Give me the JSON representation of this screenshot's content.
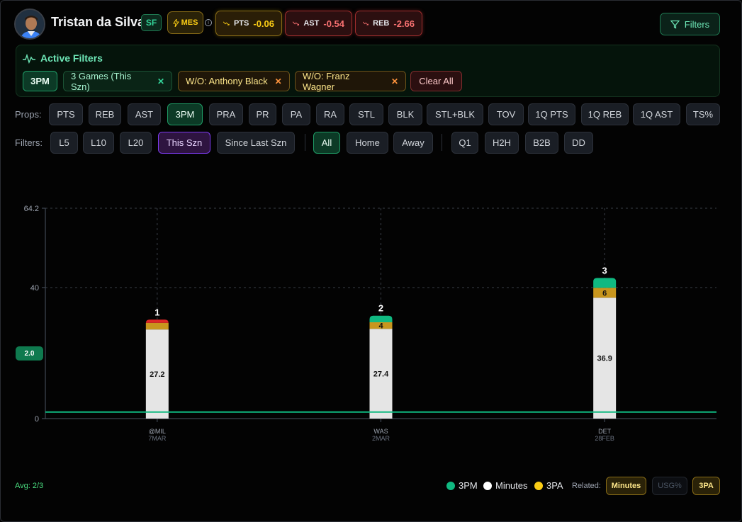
{
  "player": {
    "name": "Tristan da Silva",
    "position": "SF",
    "badge": "MES",
    "avatar_icon": "player-headshot"
  },
  "stats": [
    {
      "label": "PTS",
      "value": "-0.06"
    },
    {
      "label": "AST",
      "value": "-0.54"
    },
    {
      "label": "REB",
      "value": "-2.66"
    }
  ],
  "filters_button": "Filters",
  "active_filters": {
    "title": "Active Filters",
    "tags": [
      "3PM",
      "3 Games (This Szn)",
      "W/O: Anthony Black",
      "W/O: Franz Wagner"
    ],
    "clear_label": "Clear All"
  },
  "props": {
    "label": "Props:",
    "items": [
      "PTS",
      "REB",
      "AST",
      "3PM",
      "PRA",
      "PR",
      "PA",
      "RA",
      "STL",
      "BLK",
      "STL+BLK",
      "TOV",
      "1Q PTS",
      "1Q REB",
      "1Q AST",
      "TS%"
    ],
    "selected": "3PM"
  },
  "filter_row": {
    "label": "Filters:",
    "range": [
      "L5",
      "L10",
      "L20",
      "This Szn",
      "Since Last Szn"
    ],
    "venue": [
      "All",
      "Home",
      "Away"
    ],
    "other": [
      "Q1",
      "H2H",
      "B2B",
      "DD"
    ],
    "selected_range": "This Szn",
    "selected_venue": "All"
  },
  "chart_data": {
    "type": "bar",
    "stacked": true,
    "ylim": [
      0,
      64.2
    ],
    "yticks": [
      "0",
      "40",
      "64.2"
    ],
    "line_value": "2.0",
    "categories": [
      {
        "opp": "@MIL",
        "date": "7MAR"
      },
      {
        "opp": "WAS",
        "date": "2MAR"
      },
      {
        "opp": "DET",
        "date": "28FEB"
      }
    ],
    "series": [
      {
        "name": "Minutes",
        "values": [
          27.2,
          27.4,
          36.9
        ],
        "labels": [
          "27.2",
          "27.4",
          "36.9"
        ],
        "color": "#e5e5e5"
      },
      {
        "name": "3PA",
        "values": [
          3,
          4,
          6
        ],
        "labels": [
          "",
          "4",
          "6"
        ],
        "color": "#c8961e"
      },
      {
        "name": "3PM",
        "values": [
          1,
          2,
          3
        ],
        "color": "#10b981",
        "miss_color": "#dc2626"
      }
    ],
    "top_labels": [
      "1",
      "2",
      "3"
    ],
    "grid": true
  },
  "footer": {
    "avg": "Avg: 2/3",
    "legend": [
      {
        "name": "3PM",
        "color": "#10b981"
      },
      {
        "name": "Minutes",
        "color": "#ffffff"
      },
      {
        "name": "3PA",
        "color": "#facc15"
      }
    ],
    "related_label": "Related:",
    "related": [
      "Minutes",
      "USG%",
      "3PA"
    ]
  }
}
